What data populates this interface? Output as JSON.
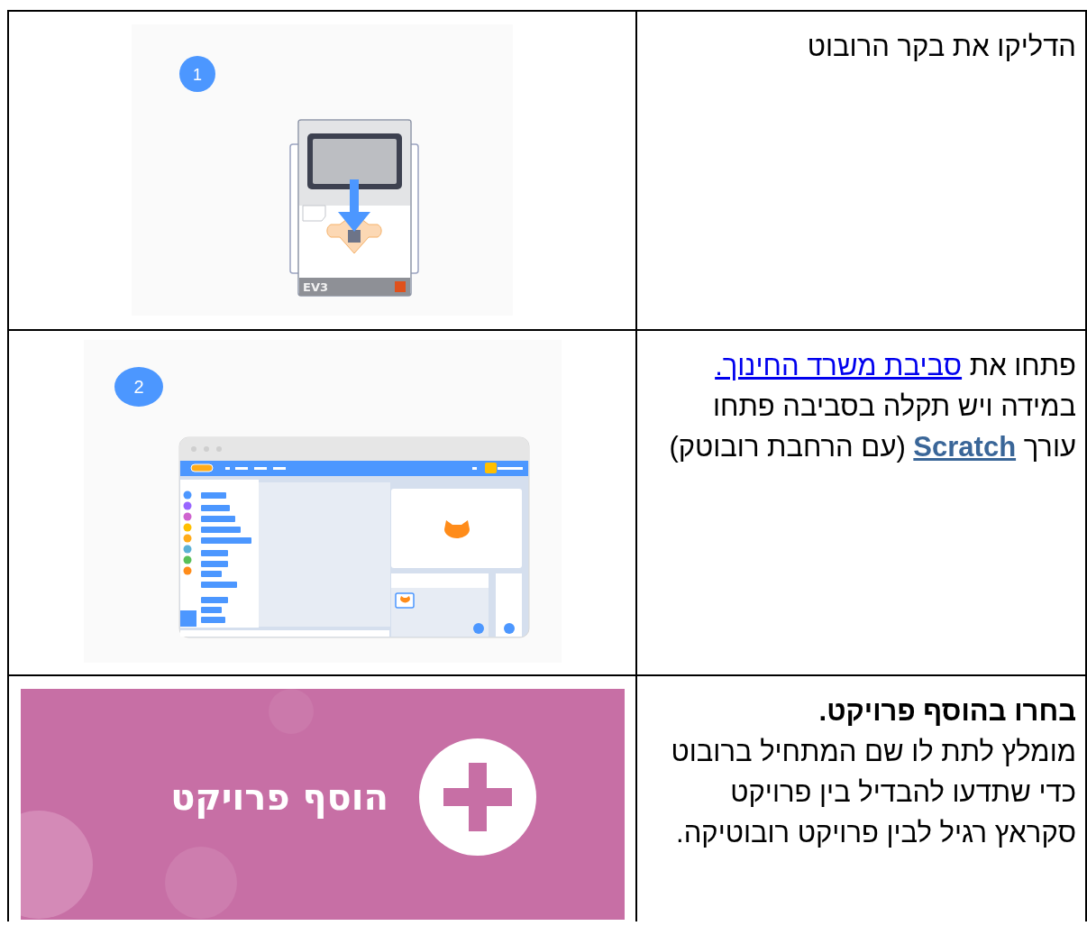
{
  "rows": [
    {
      "picture": {
        "kind": "ev3-brick",
        "badge": "1",
        "label": "EV3"
      },
      "paragraphs": [
        {
          "bold": false,
          "runs": [
            {
              "kind": "plain",
              "text": "הדליקו את בקר הרובוט"
            }
          ]
        }
      ]
    },
    {
      "picture": {
        "kind": "scratch-editor",
        "badge": "2"
      },
      "paragraphs": [
        {
          "bold": false,
          "runs": [
            {
              "kind": "plain",
              "text": "פתחו את "
            },
            {
              "kind": "link",
              "text": "סביבת משרד החינוך."
            }
          ]
        },
        {
          "bold": false,
          "runs": [
            {
              "kind": "plain",
              "text": "במידה ויש תקלה בסביבה פתחו עורך "
            },
            {
              "kind": "bold-link",
              "text": "Scratch"
            },
            {
              "kind": "plain",
              "text": " (עם הרחבת רובוטק)"
            }
          ]
        }
      ]
    },
    {
      "picture": {
        "kind": "add-project-button",
        "label": "הוסף פרויקט"
      },
      "paragraphs": [
        {
          "bold": true,
          "runs": [
            {
              "kind": "plain",
              "text": "בחרו בהוסף פרויקט."
            }
          ]
        },
        {
          "bold": false,
          "runs": [
            {
              "kind": "plain",
              "text": "מומלץ לתת לו שם המתחיל ברובוט כדי שתדעו להבדיל בין פרויקט סקראץ רגיל לבין פרויקט רובוטיקה."
            }
          ]
        }
      ]
    }
  ]
}
